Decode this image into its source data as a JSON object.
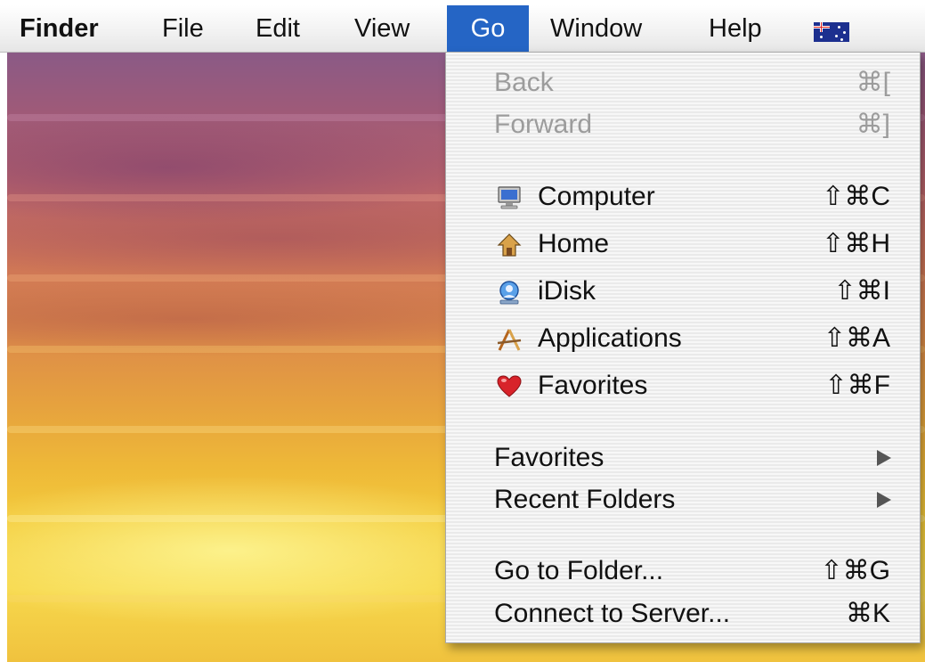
{
  "menubar": {
    "items": [
      {
        "label": "Finder"
      },
      {
        "label": "File"
      },
      {
        "label": "Edit"
      },
      {
        "label": "View"
      },
      {
        "label": "Go"
      },
      {
        "label": "Window"
      },
      {
        "label": "Help"
      }
    ],
    "active_menu": "Go",
    "input_menu_icon": "australia-flag-icon"
  },
  "go_menu": {
    "items": [
      {
        "label": "Back",
        "shortcut": "⌘[",
        "enabled": false
      },
      {
        "label": "Forward",
        "shortcut": "⌘]",
        "enabled": false
      },
      {
        "label": "Computer",
        "shortcut": "⇧⌘C",
        "icon": "computer-icon"
      },
      {
        "label": "Home",
        "shortcut": "⇧⌘H",
        "icon": "home-icon"
      },
      {
        "label": "iDisk",
        "shortcut": "⇧⌘I",
        "icon": "idisk-icon"
      },
      {
        "label": "Applications",
        "shortcut": "⇧⌘A",
        "icon": "applications-icon"
      },
      {
        "label": "Favorites",
        "shortcut": "⇧⌘F",
        "icon": "heart-icon"
      },
      {
        "label": "Favorites",
        "submenu": true
      },
      {
        "label": "Recent Folders",
        "submenu": true
      },
      {
        "label": "Go to Folder...",
        "shortcut": "⇧⌘G"
      },
      {
        "label": "Connect to Server...",
        "shortcut": "⌘K"
      }
    ]
  },
  "colors": {
    "menu_highlight": "#2565c5",
    "disabled_text": "#9c9c9c"
  }
}
